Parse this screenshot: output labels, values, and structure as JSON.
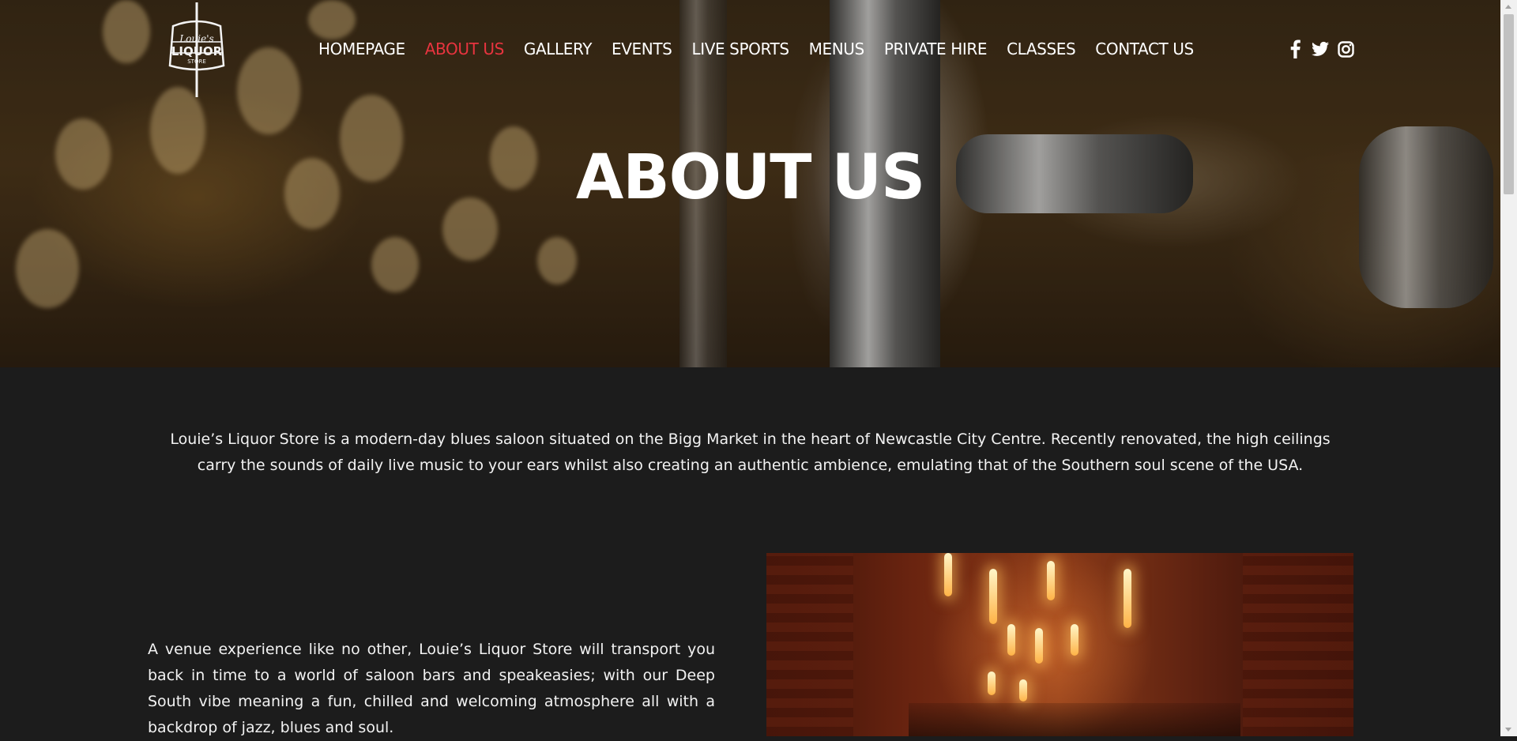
{
  "brand": {
    "logo_top": "Louie's",
    "logo_main": "LIQUOR",
    "logo_sub": "STORE"
  },
  "nav": {
    "items": [
      {
        "label": "HOMEPAGE",
        "active": false
      },
      {
        "label": "ABOUT US",
        "active": true
      },
      {
        "label": "GALLERY",
        "active": false
      },
      {
        "label": "EVENTS",
        "active": false
      },
      {
        "label": "LIVE SPORTS",
        "active": false
      },
      {
        "label": "MENUS",
        "active": false
      },
      {
        "label": "PRIVATE HIRE",
        "active": false
      },
      {
        "label": "CLASSES",
        "active": false
      },
      {
        "label": "CONTACT US",
        "active": false
      }
    ],
    "active_color": "#e8343f"
  },
  "social": {
    "icons": [
      "facebook-icon",
      "twitter-icon",
      "instagram-icon"
    ]
  },
  "hero": {
    "title": "ABOUT US"
  },
  "content": {
    "intro": "Louie’s Liquor Store is a modern-day blues saloon situated on the Bigg Market in the heart of Newcastle City Centre. Recently renovated, the high ceilings carry the sounds of daily live music to your ears whilst also creating an authentic ambience, emulating that of the Southern soul scene of the USA.",
    "paragraph": "A venue experience like no other, Louie’s Liquor Store will transport you back in time to a world of saloon bars and speakeasies; with our Deep South vibe meaning a fun, chilled and welcoming atmosphere all with a backdrop of jazz, blues and soul."
  },
  "colors": {
    "page_bg": "#1c1c1c",
    "text": "#ffffff"
  }
}
